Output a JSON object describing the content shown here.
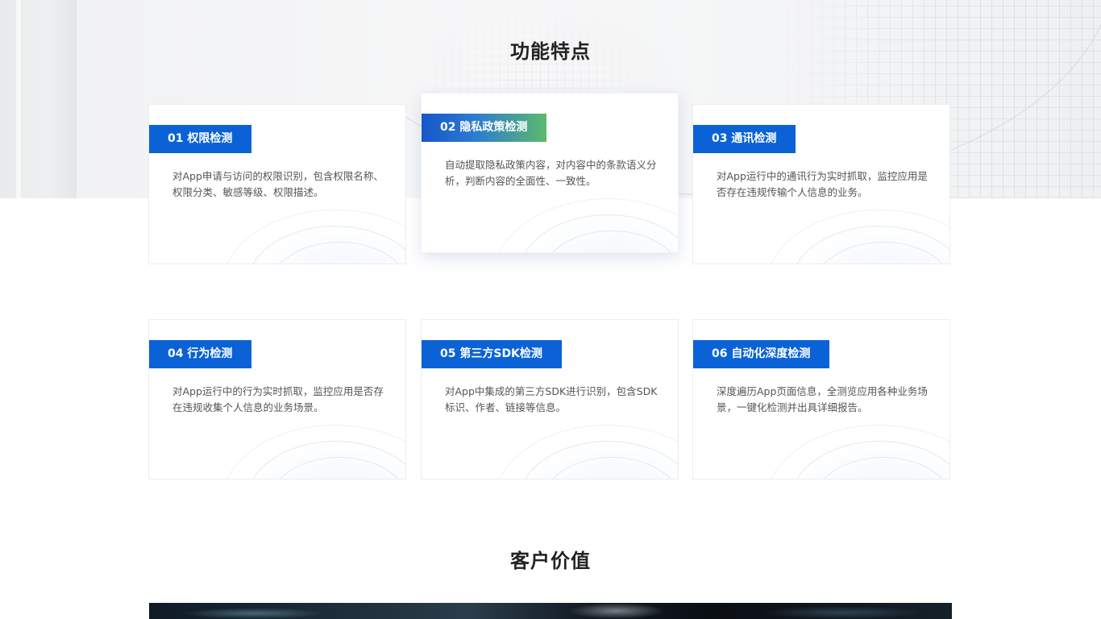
{
  "features": {
    "title": "功能特点",
    "cards": [
      {
        "tag": "01 权限检测",
        "description": "对App申请与访问的权限识别，包含权限名称、权限分类、敏感等级、权限描述。"
      },
      {
        "tag": "02 隐私政策检测",
        "description": "自动提取隐私政策内容，对内容中的条款语义分析，判断内容的全面性、一致性。"
      },
      {
        "tag": "03 通讯检测",
        "description": "对App运行中的通讯行为实时抓取，监控应用是否存在违规传输个人信息的业务。"
      },
      {
        "tag": "04 行为检测",
        "description": "对App运行中的行为实时抓取，监控应用是否存在违规收集个人信息的业务场景。"
      },
      {
        "tag": "05 第三方SDK检测",
        "description": "对App中集成的第三方SDK进行识别，包含SDK标识、作者、链接等信息。"
      },
      {
        "tag": "06 自动化深度检测",
        "description": "深度遍历App页面信息，全测览应用各种业务场景，一键化检测并出具详细报告。"
      }
    ]
  },
  "customer_value": {
    "title": "客户价值"
  },
  "colors": {
    "tag_blue": "#0a62d6",
    "tag_gradient_start": "#1556c9",
    "tag_gradient_end": "#5cba6b"
  }
}
